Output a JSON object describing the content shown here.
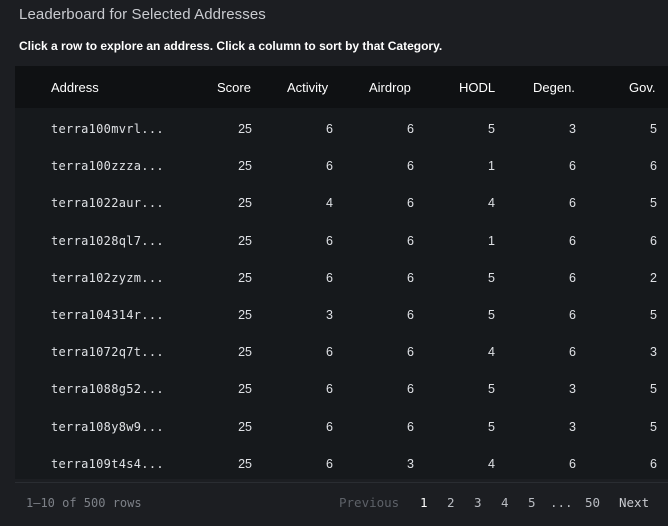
{
  "panel": {
    "title": "Leaderboard for Selected Addresses",
    "subtitle": "Click a row to explore an address. Click a column to sort by that Category."
  },
  "table": {
    "columns": [
      "Address",
      "Score",
      "Activity",
      "Airdrop",
      "HODL",
      "Degen.",
      "Gov."
    ],
    "rows": [
      [
        "terra100mvrl...",
        "25",
        "6",
        "6",
        "5",
        "3",
        "5"
      ],
      [
        "terra100zzza...",
        "25",
        "6",
        "6",
        "1",
        "6",
        "6"
      ],
      [
        "terra1022aur...",
        "25",
        "4",
        "6",
        "4",
        "6",
        "5"
      ],
      [
        "terra1028ql7...",
        "25",
        "6",
        "6",
        "1",
        "6",
        "6"
      ],
      [
        "terra102zyzm...",
        "25",
        "6",
        "6",
        "5",
        "6",
        "2"
      ],
      [
        "terra104314r...",
        "25",
        "3",
        "6",
        "5",
        "6",
        "5"
      ],
      [
        "terra1072q7t...",
        "25",
        "6",
        "6",
        "4",
        "6",
        "3"
      ],
      [
        "terra1088g52...",
        "25",
        "6",
        "6",
        "5",
        "3",
        "5"
      ],
      [
        "terra108y8w9...",
        "25",
        "6",
        "6",
        "5",
        "3",
        "5"
      ],
      [
        "terra109t4s4...",
        "25",
        "6",
        "3",
        "4",
        "6",
        "6"
      ]
    ]
  },
  "footer": {
    "rows_info": "1–10 of 500 rows",
    "previous": "Previous",
    "pages": [
      "1",
      "2",
      "3",
      "4",
      "5"
    ],
    "ellipsis": "...",
    "last_page": "50",
    "next": "Next",
    "current_page": "1"
  },
  "colors": {
    "background": "#1c1e22",
    "header_bg": "#0f1113",
    "table_bg": "#16191c"
  }
}
